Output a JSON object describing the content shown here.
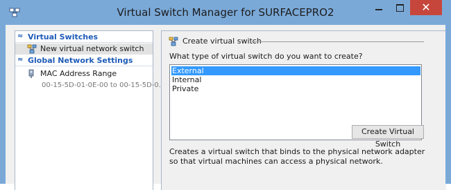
{
  "window": {
    "title": "Virtual Switch Manager for SURFACEPRO2",
    "close_glyph": "✕"
  },
  "sidebar": {
    "sections": [
      {
        "label": "Virtual Switches",
        "items": [
          {
            "label": "New virtual network switch",
            "icon": "new-switch-icon",
            "selected": true
          }
        ]
      },
      {
        "label": "Global Network Settings",
        "items": [
          {
            "label": "MAC Address Range",
            "icon": "network-adapter-icon",
            "sub": "00-15-5D-01-0E-00 to 00-15-5D-0..."
          }
        ]
      }
    ],
    "chevron_glyph": "≈"
  },
  "main": {
    "group_title": "Create virtual switch",
    "question": "What type of virtual switch do you want to create?",
    "options": [
      "External",
      "Internal",
      "Private"
    ],
    "selected_option": "External",
    "create_button": "Create Virtual Switch",
    "description": "Creates a virtual switch that binds to the physical network adapter so that virtual machines can access a physical network."
  },
  "colors": {
    "title_bar": "#7aa9d8",
    "close_button": "#c7463c",
    "selection": "#3399ff",
    "section_header": "#1e5bb8"
  }
}
